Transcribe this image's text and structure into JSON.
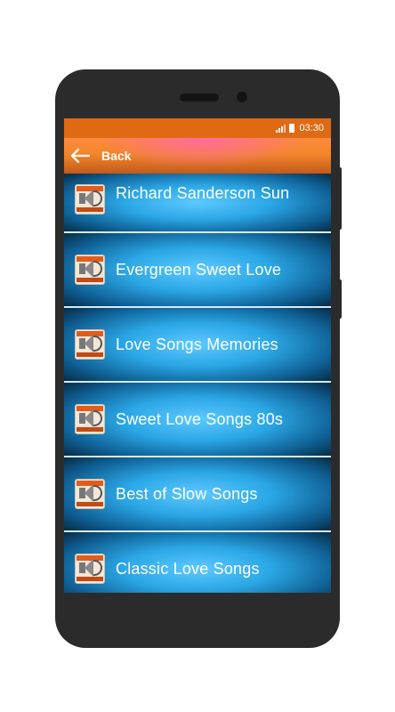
{
  "status": {
    "time": "03:30"
  },
  "appbar": {
    "title": "Back"
  },
  "icons": {
    "back": "arrow-left",
    "thumb": "speaker-volume"
  },
  "colors": {
    "statusbar": "#e06a14",
    "row_center": "#5ec9ff",
    "row_edge": "#05273f"
  },
  "list": [
    {
      "label": "Richard Sanderson Sun"
    },
    {
      "label": "Evergreen Sweet Love"
    },
    {
      "label": "Love Songs Memories"
    },
    {
      "label": "Sweet Love Songs 80s"
    },
    {
      "label": "Best of Slow Songs"
    },
    {
      "label": "Classic Love Songs"
    }
  ]
}
